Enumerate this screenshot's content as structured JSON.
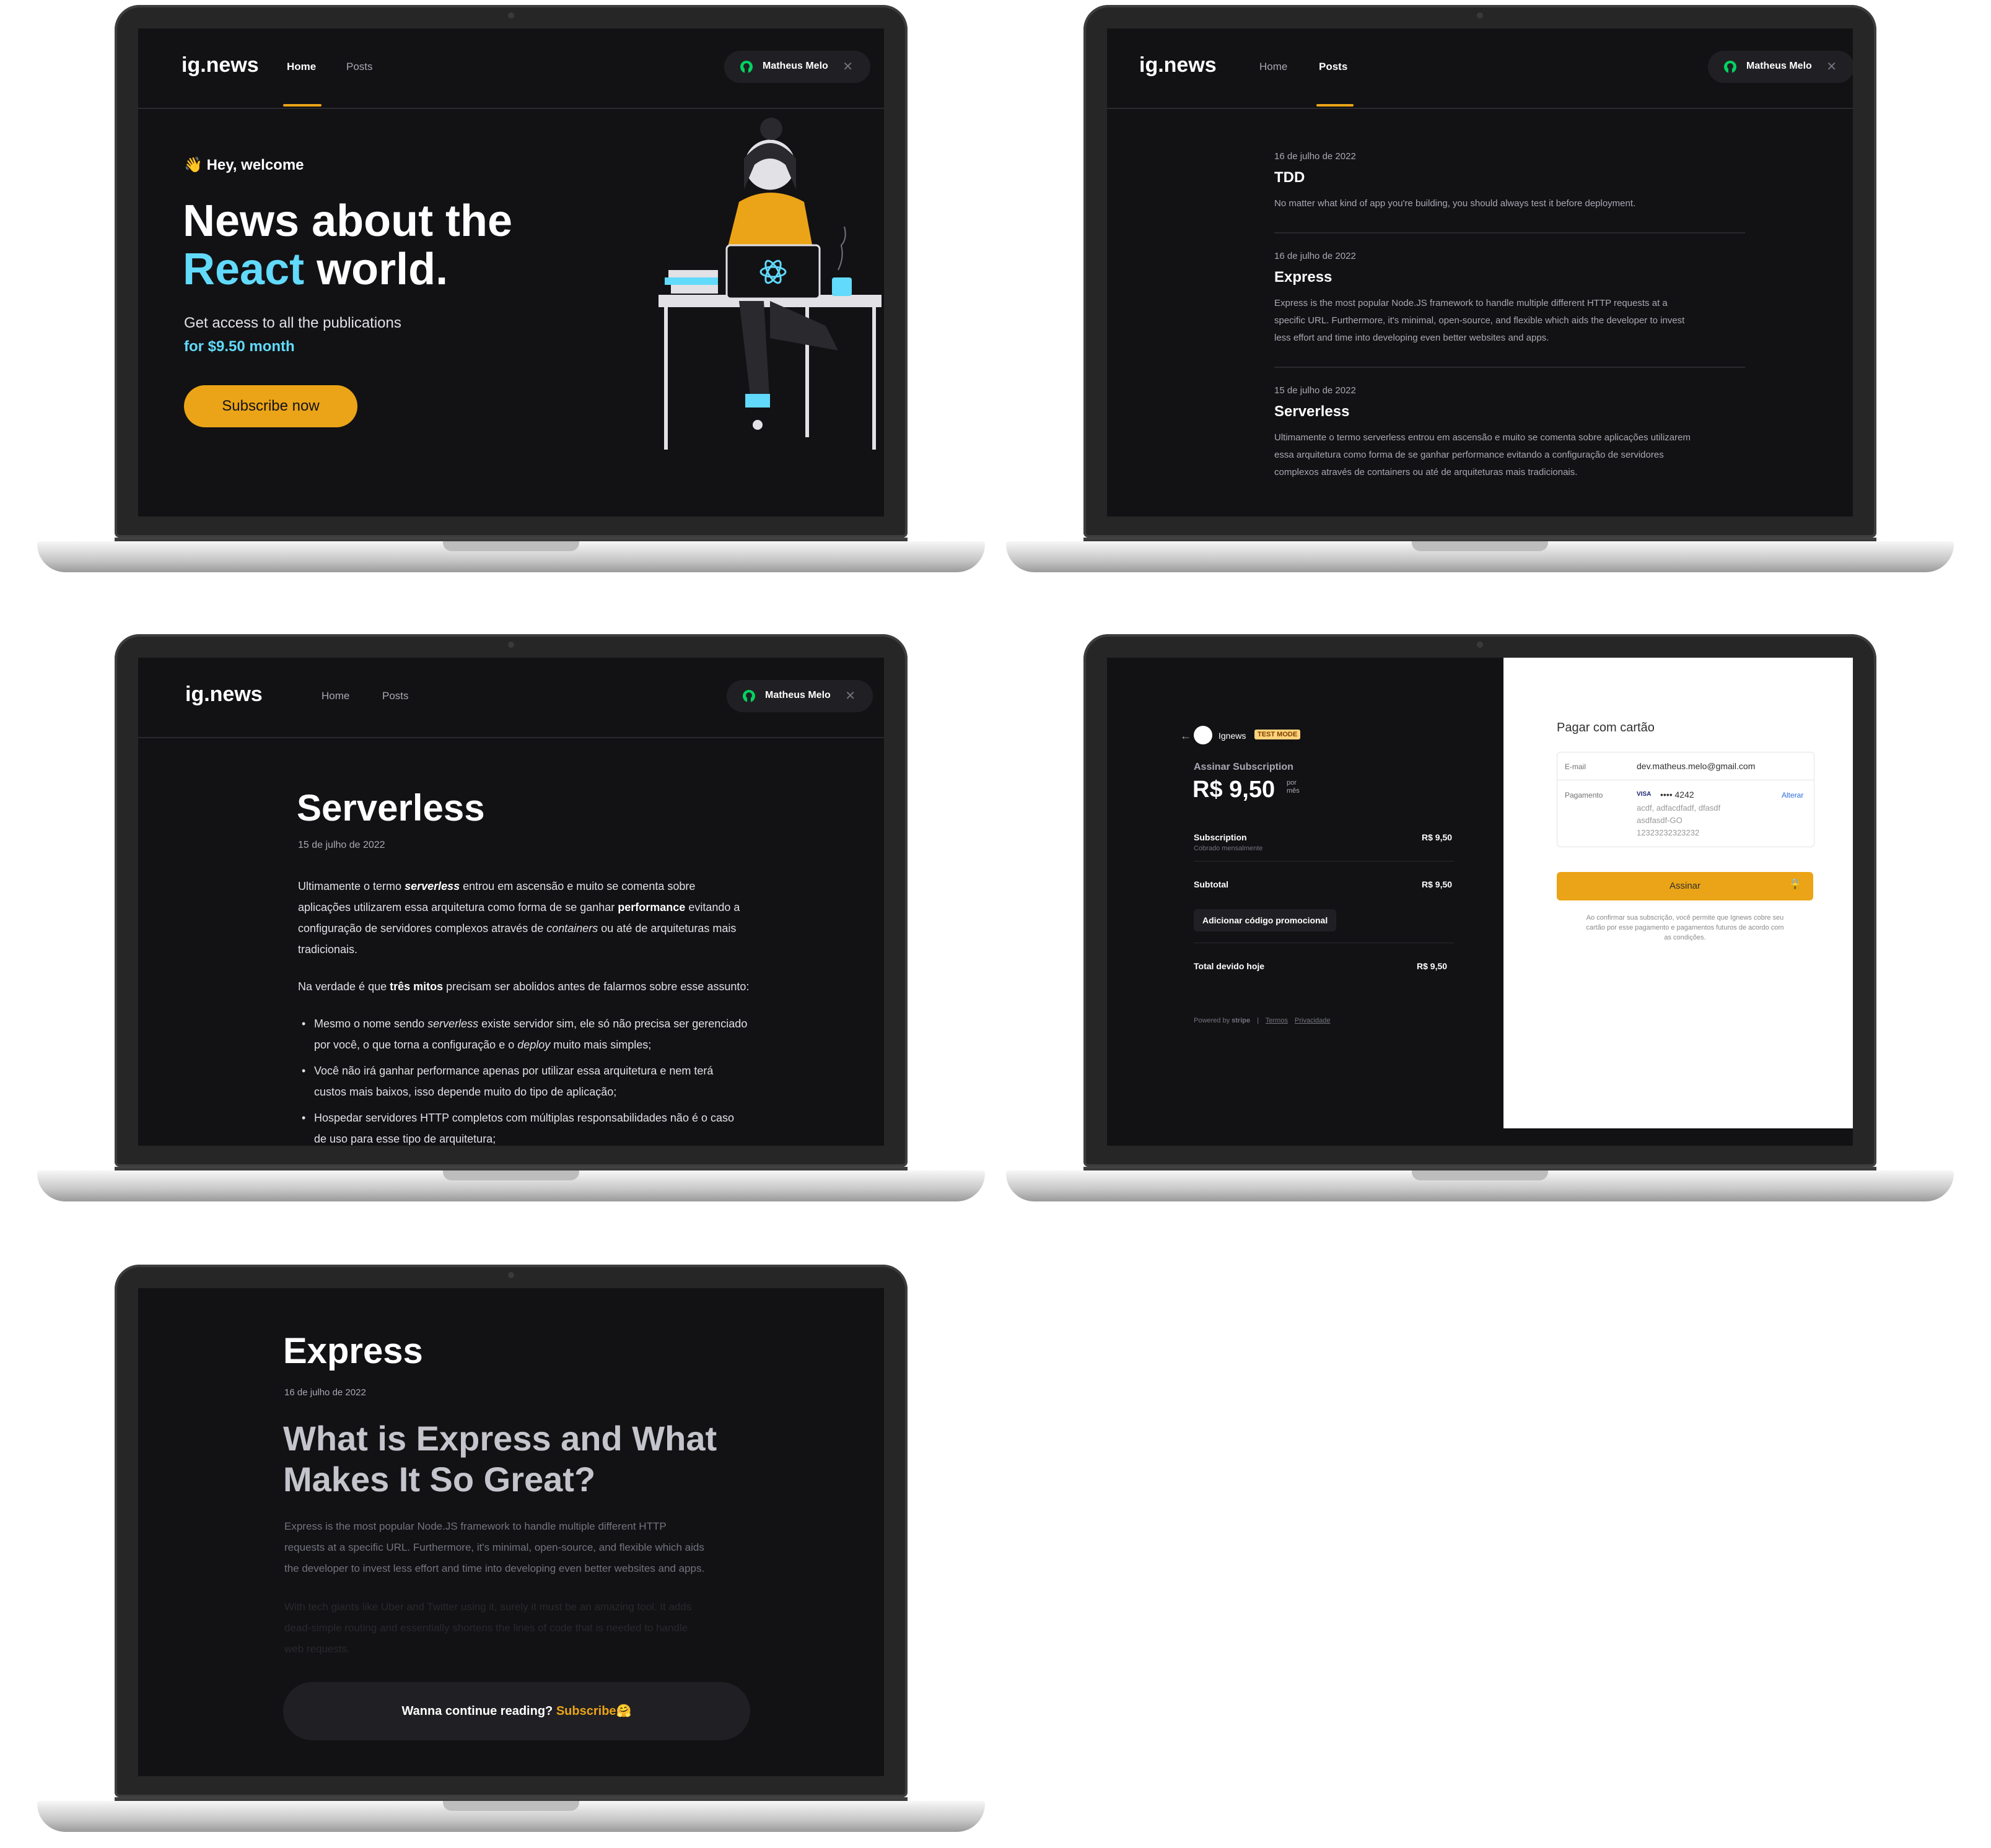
{
  "nav": {
    "logo": "ig.news",
    "home": "Home",
    "posts": "Posts",
    "user": "Matheus Melo"
  },
  "home": {
    "welcome": "Hey, welcome",
    "headline_line1": "News about the",
    "headline_react": "React",
    "headline_rest": "world.",
    "access": "Get access to all the publications",
    "price": "for $9.50 month",
    "subscribe": "Subscribe now"
  },
  "posts": [
    {
      "date": "16 de julho de 2022",
      "title": "TDD",
      "lines": [
        "No matter what kind of app you're building, you should always test it before deployment."
      ]
    },
    {
      "date": "16 de julho de 2022",
      "title": "Express",
      "lines": [
        "Express is the most popular Node.JS framework to handle multiple different HTTP requests at a",
        "specific URL. Furthermore, it's minimal, open-source, and flexible which aids the developer to invest",
        "less effort and time into developing even better websites and apps."
      ]
    },
    {
      "date": "15 de julho de 2022",
      "title": "Serverless",
      "lines": [
        "Ultimamente o termo serverless entrou em ascensão e muito se comenta sobre aplicações utilizarem",
        "essa arquitetura como forma de se ganhar performance evitando a configuração de servidores",
        "complexos através de containers ou até de arquiteturas mais tradicionais."
      ]
    }
  ],
  "article": {
    "title": "Serverless",
    "date": "15 de julho de 2022",
    "p1": [
      [
        {
          "t": "Ultimamente o termo "
        },
        {
          "t": "serverless",
          "b": true,
          "i": true
        },
        {
          "t": " entrou em ascensão e muito se comenta sobre"
        }
      ],
      [
        {
          "t": "aplicações utilizarem essa arquitetura como forma de se ganhar "
        },
        {
          "t": "performance",
          "b": true
        },
        {
          "t": " evitando a"
        }
      ],
      [
        {
          "t": "configuração de servidores complexos através de "
        },
        {
          "t": "containers",
          "i": true
        },
        {
          "t": " ou até de arquiteturas mais"
        }
      ],
      [
        {
          "t": "tradicionais."
        }
      ]
    ],
    "p2": [
      {
        "t": "Na verdade é que "
      },
      {
        "t": "três mitos",
        "b": true
      },
      {
        "t": " precisam ser abolidos antes de falarmos sobre esse assunto:"
      }
    ],
    "bullets": [
      [
        [
          {
            "t": "Mesmo o nome sendo "
          },
          {
            "t": "serverless",
            "i": true
          },
          {
            "t": " existe servidor sim, ele só não precisa ser gerenciado"
          }
        ],
        [
          {
            "t": "por você, o que torna a configuração e o "
          },
          {
            "t": "deploy",
            "i": true
          },
          {
            "t": " muito mais simples;"
          }
        ]
      ],
      [
        [
          {
            "t": "Você não irá ganhar performance apenas por utilizar essa arquitetura e nem terá"
          }
        ],
        [
          {
            "t": "custos mais baixos, isso depende muito do tipo de aplicação;"
          }
        ]
      ],
      [
        [
          {
            "t": "Hospedar servidores HTTP completos com múltiplas responsabilidades não é o caso"
          }
        ],
        [
          {
            "t": "de uso para esse tipo de arquitetura;"
          }
        ]
      ]
    ]
  },
  "checkout": {
    "brand": "Ignews",
    "test_mode": "TEST MODE",
    "plan": "Assinar Subscription",
    "price": "R$ 9,50",
    "per_line1": "por",
    "per_line2": "mês",
    "item": "Subscription",
    "item_sub": "Cobrado mensalmente",
    "item_price": "R$ 9,50",
    "subtotal": "Subtotal",
    "subtotal_price": "R$ 9,50",
    "promo": "Adicionar código promocional",
    "total": "Total devido hoje",
    "total_price": "R$ 9,50",
    "powered_by": "Powered by",
    "stripe": "stripe",
    "terms": "Termos",
    "privacy": "Privacidade",
    "pay_title": "Pagar com cartão",
    "email_label": "E-mail",
    "email_value": "dev.matheus.melo@gmail.com",
    "payment_label": "Pagamento",
    "card_brand": "VISA",
    "card_number": "•••• 4242",
    "change": "Alterar",
    "addr1": "acdf, adfacdfadf, dfasdf",
    "addr2": "asdfasdf-GO",
    "addr3": "12323232323232",
    "pay_button": "Assinar",
    "disclaimer1": "Ao confirmar sua subscrição, você permite que Ignews cobre seu",
    "disclaimer2": "cartão por esse pagamento e pagamentos futuros de acordo com",
    "disclaimer3": "as condições."
  },
  "preview": {
    "title": "Express",
    "date": "16 de julho de 2022",
    "heading1": "What is Express and What",
    "heading2": "Makes It So Great?",
    "p1": [
      "Express is the most popular Node.JS framework to handle multiple different HTTP",
      "requests at a specific URL. Furthermore, it's minimal, open-source, and flexible which aids",
      "the developer to invest less effort and time into developing even better websites and apps."
    ],
    "p2": [
      "With tech giants like Uber and Twitter using it, surely it must be an amazing tool. It adds",
      "dead-simple routing and essentially shortens the lines of code that is needed to handle",
      "web requests."
    ],
    "cta": "Wanna continue reading?",
    "cta_link": "Subscribe",
    "cta_emoji": "🤗"
  },
  "colors": {
    "accent": "#eba417",
    "cyan": "#61dafb",
    "bg": "#121214",
    "gray": "#a8a8b3"
  }
}
